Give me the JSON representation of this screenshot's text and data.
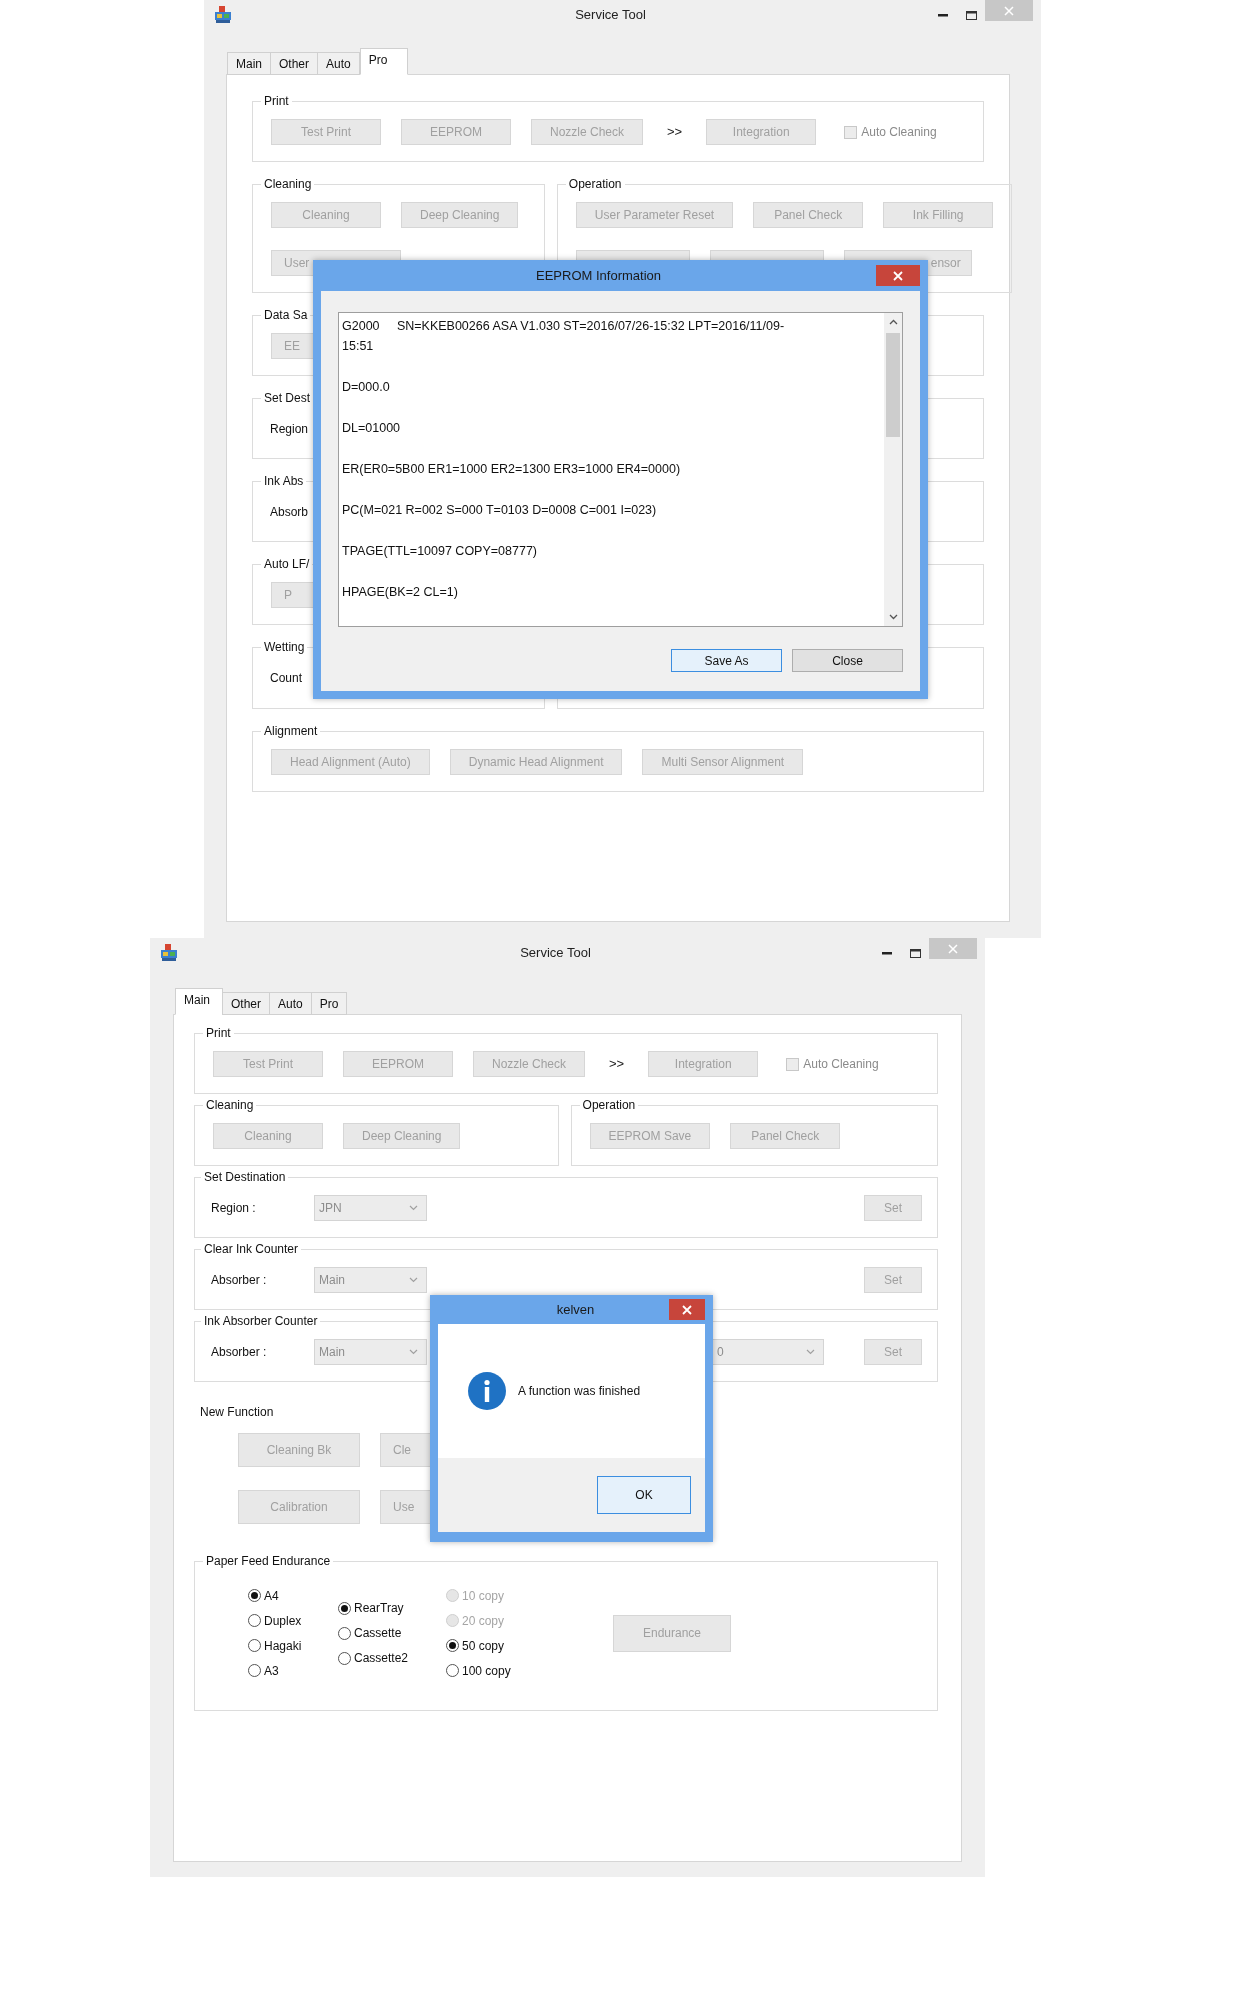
{
  "windows": [
    {
      "title": "Service Tool",
      "tabs": [
        {
          "label": "Main",
          "selected": false
        },
        {
          "label": "Other",
          "selected": false
        },
        {
          "label": "Auto",
          "selected": false
        },
        {
          "label": "Pro",
          "selected": true
        }
      ],
      "sections": [
        {
          "kind": "group",
          "title": "Print",
          "rows": [
            [
              {
                "kind": "button",
                "label": "Test Print",
                "disabled": true
              },
              {
                "kind": "button",
                "label": "EEPROM",
                "disabled": true
              },
              {
                "kind": "button",
                "label": "Nozzle Check",
                "disabled": true
              },
              {
                "kind": "text",
                "label": ">>"
              },
              {
                "kind": "button",
                "label": "Integration",
                "disabled": true
              },
              {
                "kind": "checkbox",
                "label": "Auto Cleaning",
                "checked": false,
                "disabled": true
              }
            ]
          ]
        },
        {
          "kind": "pair",
          "groups": [
            {
              "kind": "group",
              "title": "Cleaning",
              "rows": [
                [
                  {
                    "kind": "button",
                    "label": "Cleaning",
                    "disabled": true
                  },
                  {
                    "kind": "button",
                    "label": "Deep Cleaning",
                    "disabled": true
                  }
                ],
                [
                  {
                    "kind": "cut_button",
                    "label": "User",
                    "disabled": true
                  }
                ]
              ]
            },
            {
              "kind": "group",
              "title": "Operation",
              "rows": [
                [
                  {
                    "kind": "button",
                    "label": "User Parameter Reset",
                    "disabled": true
                  },
                  {
                    "kind": "button",
                    "label": "Panel Check",
                    "disabled": true
                  },
                  {
                    "kind": "button",
                    "label": "Ink Filling",
                    "disabled": true
                  }
                ],
                [
                  {
                    "kind": "covered_button"
                  },
                  {
                    "kind": "covered_button"
                  },
                  {
                    "kind": "cut_button_end",
                    "label": "ensor",
                    "disabled": true
                  }
                ]
              ]
            }
          ]
        },
        {
          "kind": "group",
          "title": "Data Sa",
          "rows": [
            [
              {
                "kind": "cut_button",
                "label": "EE",
                "disabled": true
              }
            ]
          ]
        },
        {
          "kind": "group",
          "title": "Set Dest",
          "rows": [
            [
              {
                "kind": "label",
                "label": "Region"
              }
            ]
          ]
        },
        {
          "kind": "group",
          "title": "Ink Abs",
          "rows": [
            [
              {
                "kind": "label",
                "label": "Absorb"
              }
            ]
          ]
        },
        {
          "kind": "group",
          "title": "Auto LF/",
          "rows": [
            [
              {
                "kind": "cut_button",
                "label": "P",
                "disabled": true
              }
            ]
          ]
        },
        {
          "kind": "pair",
          "groups": [
            {
              "kind": "group",
              "title": "Wetting",
              "rows": [
                [
                  {
                    "kind": "label",
                    "label": "Count"
                  }
                ]
              ]
            },
            {
              "kind": "blank_group"
            }
          ]
        },
        {
          "kind": "group",
          "title": "Alignment",
          "rows": [
            [
              {
                "kind": "button",
                "label": "Head Alignment (Auto)",
                "disabled": true
              },
              {
                "kind": "button",
                "label": "Dynamic Head Alignment",
                "disabled": true
              },
              {
                "kind": "button",
                "label": "Multi Sensor Alignment",
                "disabled": true
              }
            ]
          ]
        }
      ],
      "dialog": {
        "kind": "text_viewer",
        "title": "EEPROM Information",
        "entries": [
          [
            "G2000     SN=KKEB00266 ASA V1.030 ST=2016/07/26-15:32 LPT=2016/11/09-",
            "15:51"
          ],
          [
            "D=000.0"
          ],
          [
            "DL=01000"
          ],
          [
            "ER(ER0=5B00 ER1=1000 ER2=1300 ER3=1000 ER4=0000)"
          ],
          [
            "PC(M=021 R=002 S=000 T=0103 D=0008 C=001 I=023)"
          ],
          [
            "TPAGE(TTL=10097 COPY=08777)"
          ],
          [
            "HPAGE(BK=2 CL=1)"
          ]
        ],
        "buttons": [
          {
            "label": "Save As",
            "focused": true
          },
          {
            "label": "Close",
            "focused": false
          }
        ]
      }
    },
    {
      "title": "Service Tool",
      "tabs": [
        {
          "label": "Main",
          "selected": true
        },
        {
          "label": "Other",
          "selected": false
        },
        {
          "label": "Auto",
          "selected": false
        },
        {
          "label": "Pro",
          "selected": false
        }
      ],
      "sections": [
        {
          "kind": "group",
          "title": "Print",
          "rows": [
            [
              {
                "kind": "button",
                "label": "Test Print",
                "disabled": true
              },
              {
                "kind": "button",
                "label": "EEPROM",
                "disabled": true
              },
              {
                "kind": "button",
                "label": "Nozzle Check",
                "disabled": true
              },
              {
                "kind": "text",
                "label": ">>"
              },
              {
                "kind": "button",
                "label": "Integration",
                "disabled": true
              },
              {
                "kind": "checkbox",
                "label": "Auto Cleaning",
                "checked": false,
                "disabled": true
              }
            ]
          ]
        },
        {
          "kind": "pair",
          "groups": [
            {
              "kind": "group",
              "title": "Cleaning",
              "rows": [
                [
                  {
                    "kind": "button",
                    "label": "Cleaning",
                    "disabled": true
                  },
                  {
                    "kind": "button",
                    "label": "Deep Cleaning",
                    "disabled": true
                  }
                ]
              ]
            },
            {
              "kind": "group",
              "title": "Operation",
              "rows": [
                [
                  {
                    "kind": "button",
                    "label": "EEPROM Save",
                    "disabled": true
                  },
                  {
                    "kind": "button",
                    "label": "Panel Check",
                    "disabled": true
                  }
                ]
              ]
            }
          ]
        },
        {
          "kind": "setting",
          "title": "Set Destination",
          "label": "Region :",
          "selects": [
            {
              "kind": "select",
              "value": "JPN",
              "disabled": true
            }
          ],
          "button": {
            "label": "Set",
            "disabled": true
          }
        },
        {
          "kind": "setting",
          "title": "Clear Ink Counter",
          "label": "Absorber :",
          "selects": [
            {
              "kind": "select",
              "value": "Main",
              "disabled": true
            }
          ],
          "button": {
            "label": "Set",
            "disabled": true
          }
        },
        {
          "kind": "setting",
          "title": "Ink Absorber Counter",
          "label": "Absorber :",
          "selects": [
            {
              "kind": "select",
              "value": "Main",
              "disabled": true
            },
            {
              "kind": "cut_select",
              "value": "0",
              "disabled": true
            }
          ],
          "button": {
            "label": "Set",
            "disabled": true
          }
        },
        {
          "kind": "plain",
          "title": "New Function",
          "rows": [
            [
              {
                "kind": "button",
                "label": "Cleaning Bk",
                "disabled": true
              },
              {
                "kind": "cut_button",
                "label": "Cle",
                "disabled": true
              }
            ],
            [
              {
                "kind": "button",
                "label": "Calibration",
                "disabled": true
              },
              {
                "kind": "cut_button",
                "label": "Use",
                "disabled": true
              }
            ]
          ]
        },
        {
          "kind": "radios",
          "title": "Paper Feed Endurance",
          "columns": [
            [
              {
                "label": "A4",
                "selected": true,
                "disabled": false
              },
              {
                "label": "Duplex",
                "selected": false,
                "disabled": false
              },
              {
                "label": "Hagaki",
                "selected": false,
                "disabled": false
              },
              {
                "label": "A3",
                "selected": false,
                "disabled": false
              }
            ],
            [
              {
                "label": "RearTray",
                "selected": true,
                "disabled": false
              },
              {
                "label": "Cassette",
                "selected": false,
                "disabled": false
              },
              {
                "label": "Cassette2",
                "selected": false,
                "disabled": false
              }
            ],
            [
              {
                "label": "10 copy",
                "selected": false,
                "disabled": true
              },
              {
                "label": "20 copy",
                "selected": false,
                "disabled": true
              },
              {
                "label": "50 copy",
                "selected": true,
                "disabled": false
              },
              {
                "label": "100 copy",
                "selected": false,
                "disabled": false
              }
            ]
          ],
          "button": {
            "label": "Endurance",
            "disabled": true
          }
        }
      ],
      "dialog": {
        "kind": "message",
        "title": "kelven",
        "message": "A function was finished",
        "buttons": [
          {
            "label": "OK",
            "focused": true
          }
        ]
      }
    }
  ]
}
